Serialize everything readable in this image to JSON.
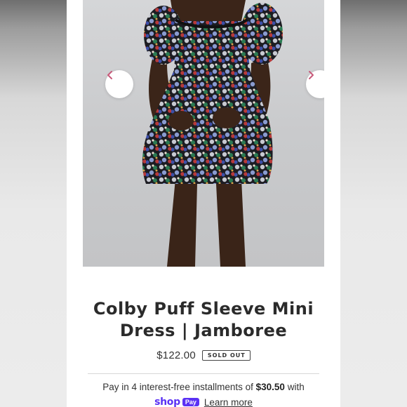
{
  "product": {
    "title": "Colby Puff Sleeve Mini Dress | Jamboree",
    "price": "$122.00",
    "status_badge": "SOLD OUT"
  },
  "gallery": {
    "prev_icon": "chevron-left-icon",
    "next_icon": "chevron-right-icon",
    "accent_color": "#c85a7a"
  },
  "payment": {
    "installments_prefix": "Pay in 4 interest-free installments of",
    "installment_amount": "$30.50",
    "installments_suffix": "with",
    "provider_logo": "shop",
    "provider_logo_suffix": "Pay",
    "learn_more": "Learn more",
    "brand_color": "#5a31f4"
  }
}
